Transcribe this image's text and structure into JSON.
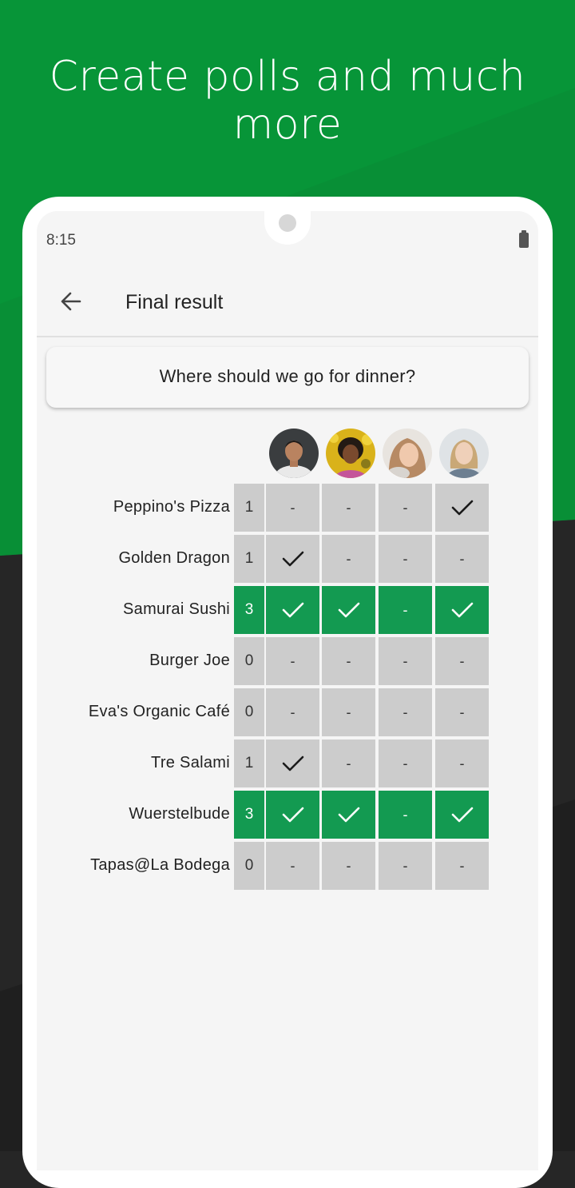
{
  "headline": "Create polls and much more",
  "status_bar": {
    "time": "8:15"
  },
  "app_bar": {
    "title": "Final result",
    "back_icon": "arrow-back-icon"
  },
  "question": "Where should we go for dinner?",
  "participants": [
    {
      "name": "participant-1"
    },
    {
      "name": "participant-2"
    },
    {
      "name": "participant-3"
    },
    {
      "name": "participant-4"
    }
  ],
  "colors": {
    "brand_green": "#079538",
    "winner_green": "#139a51",
    "cell_gray": "#cccccc"
  },
  "options": [
    {
      "label": "Peppino's Pizza",
      "count": "1",
      "votes": [
        "-",
        "-",
        "-",
        "✓"
      ],
      "winner": false
    },
    {
      "label": "Golden Dragon",
      "count": "1",
      "votes": [
        "✓",
        "-",
        "-",
        "-"
      ],
      "winner": false
    },
    {
      "label": "Samurai Sushi",
      "count": "3",
      "votes": [
        "✓",
        "✓",
        "-",
        "✓"
      ],
      "winner": true
    },
    {
      "label": "Burger Joe",
      "count": "0",
      "votes": [
        "-",
        "-",
        "-",
        "-"
      ],
      "winner": false
    },
    {
      "label": "Eva's Organic Café",
      "count": "0",
      "votes": [
        "-",
        "-",
        "-",
        "-"
      ],
      "winner": false
    },
    {
      "label": "Tre Salami",
      "count": "1",
      "votes": [
        "✓",
        "-",
        "-",
        "-"
      ],
      "winner": false
    },
    {
      "label": "Wuerstelbude",
      "count": "3",
      "votes": [
        "✓",
        "✓",
        "-",
        "✓"
      ],
      "winner": true
    },
    {
      "label": "Tapas@La Bodega",
      "count": "0",
      "votes": [
        "-",
        "-",
        "-",
        "-"
      ],
      "winner": false
    }
  ]
}
